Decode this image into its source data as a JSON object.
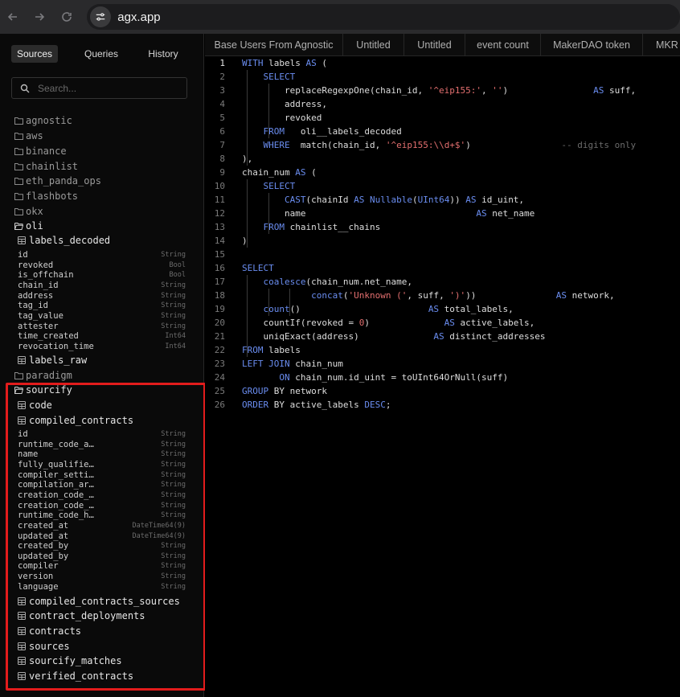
{
  "browser": {
    "url": "agx.app"
  },
  "sidebar": {
    "tabs": [
      "Sources",
      "Queries",
      "History"
    ],
    "search_placeholder": "Search...",
    "folders": [
      "agnostic",
      "aws",
      "binance",
      "chainlist",
      "eth_panda_ops",
      "flashbots",
      "okx"
    ],
    "oli": {
      "name": "oli",
      "tables": [
        {
          "name": "labels_decoded",
          "columns": [
            {
              "name": "id",
              "type": "String"
            },
            {
              "name": "revoked",
              "type": "Bool"
            },
            {
              "name": "is_offchain",
              "type": "Bool"
            },
            {
              "name": "chain_id",
              "type": "String"
            },
            {
              "name": "address",
              "type": "String"
            },
            {
              "name": "tag_id",
              "type": "String"
            },
            {
              "name": "tag_value",
              "type": "String"
            },
            {
              "name": "attester",
              "type": "String"
            },
            {
              "name": "time_created",
              "type": "Int64"
            },
            {
              "name": "revocation_time",
              "type": "Int64"
            }
          ]
        },
        {
          "name": "labels_raw"
        }
      ]
    },
    "paradigm": "paradigm",
    "sourcify": {
      "name": "sourcify",
      "tables": [
        {
          "name": "code"
        },
        {
          "name": "compiled_contracts",
          "columns": [
            {
              "name": "id",
              "type": "String"
            },
            {
              "name": "runtime_code_a…",
              "type": "String"
            },
            {
              "name": "name",
              "type": "String"
            },
            {
              "name": "fully_qualifie…",
              "type": "String"
            },
            {
              "name": "compiler_setti…",
              "type": "String"
            },
            {
              "name": "compilation_ar…",
              "type": "String"
            },
            {
              "name": "creation_code_…",
              "type": "String"
            },
            {
              "name": "creation_code_…",
              "type": "String"
            },
            {
              "name": "runtime_code_h…",
              "type": "String"
            },
            {
              "name": "created_at",
              "type": "DateTime64(9)"
            },
            {
              "name": "updated_at",
              "type": "DateTime64(9)"
            },
            {
              "name": "created_by",
              "type": "String"
            },
            {
              "name": "updated_by",
              "type": "String"
            },
            {
              "name": "compiler",
              "type": "String"
            },
            {
              "name": "version",
              "type": "String"
            },
            {
              "name": "language",
              "type": "String"
            }
          ]
        },
        {
          "name": "compiled_contracts_sources"
        },
        {
          "name": "contract_deployments"
        },
        {
          "name": "contracts"
        },
        {
          "name": "sources"
        },
        {
          "name": "sourcify_matches"
        },
        {
          "name": "verified_contracts"
        }
      ]
    }
  },
  "editor": {
    "tabs": [
      "Base Users From Agnostic",
      "Untitled",
      "Untitled",
      "event count",
      "MakerDAO token",
      "MKR"
    ],
    "active_line": 1,
    "lines": [
      [
        [
          "kw",
          "WITH"
        ],
        [
          "t",
          " labels "
        ],
        [
          "kw",
          "AS"
        ],
        [
          "t",
          " ("
        ]
      ],
      [
        [
          "t",
          "    "
        ],
        [
          "kw",
          "SELECT"
        ]
      ],
      [
        [
          "t",
          "        replaceRegexpOne(chain_id, "
        ],
        [
          "str",
          "'^eip155:'"
        ],
        [
          "t",
          ", "
        ],
        [
          "str",
          "''"
        ],
        [
          "t",
          ")                "
        ],
        [
          "kw",
          "AS"
        ],
        [
          "t",
          " suff,"
        ]
      ],
      [
        [
          "t",
          "        address,"
        ]
      ],
      [
        [
          "t",
          "        revoked"
        ]
      ],
      [
        [
          "t",
          "    "
        ],
        [
          "kw",
          "FROM"
        ],
        [
          "t",
          "   oli__labels_decoded"
        ]
      ],
      [
        [
          "t",
          "    "
        ],
        [
          "kw",
          "WHERE"
        ],
        [
          "t",
          "  match(chain_id, "
        ],
        [
          "str",
          "'^eip155:\\\\d+$'"
        ],
        [
          "t",
          ")                 "
        ],
        [
          "cm",
          "-- digits only"
        ]
      ],
      [
        [
          "t",
          "),"
        ]
      ],
      [
        [
          "t",
          "chain_num "
        ],
        [
          "kw",
          "AS"
        ],
        [
          "t",
          " ("
        ]
      ],
      [
        [
          "t",
          "    "
        ],
        [
          "kw",
          "SELECT"
        ]
      ],
      [
        [
          "t",
          "        "
        ],
        [
          "kw",
          "CAST"
        ],
        [
          "t",
          "(chainId "
        ],
        [
          "kw",
          "AS"
        ],
        [
          "t",
          " "
        ],
        [
          "kw",
          "Nullable"
        ],
        [
          "t",
          "("
        ],
        [
          "kw",
          "UInt64"
        ],
        [
          "t",
          ")) "
        ],
        [
          "kw",
          "AS"
        ],
        [
          "t",
          " id_uint,"
        ]
      ],
      [
        [
          "t",
          "        name                                "
        ],
        [
          "kw",
          "AS"
        ],
        [
          "t",
          " net_name"
        ]
      ],
      [
        [
          "t",
          "    "
        ],
        [
          "kw",
          "FROM"
        ],
        [
          "t",
          " chainlist__chains"
        ]
      ],
      [
        [
          "t",
          ")"
        ]
      ],
      [
        [
          "t",
          ""
        ]
      ],
      [
        [
          "kw",
          "SELECT"
        ]
      ],
      [
        [
          "t",
          "    "
        ],
        [
          "kw",
          "coalesce"
        ],
        [
          "t",
          "(chain_num.net_name,"
        ]
      ],
      [
        [
          "t",
          "             "
        ],
        [
          "kw",
          "concat"
        ],
        [
          "t",
          "("
        ],
        [
          "str",
          "'Unknown ('"
        ],
        [
          "t",
          ", suff, "
        ],
        [
          "str",
          "')'"
        ],
        [
          "t",
          "))               "
        ],
        [
          "kw",
          "AS"
        ],
        [
          "t",
          " network,"
        ]
      ],
      [
        [
          "t",
          "    "
        ],
        [
          "kw",
          "count"
        ],
        [
          "t",
          "()                        "
        ],
        [
          "kw",
          "AS"
        ],
        [
          "t",
          " total_labels,"
        ]
      ],
      [
        [
          "t",
          "    countIf(revoked = "
        ],
        [
          "str",
          "0"
        ],
        [
          "t",
          ")              "
        ],
        [
          "kw",
          "AS"
        ],
        [
          "t",
          " active_labels,"
        ]
      ],
      [
        [
          "t",
          "    uniqExact(address)              "
        ],
        [
          "kw",
          "AS"
        ],
        [
          "t",
          " distinct_addresses"
        ]
      ],
      [
        [
          "kw",
          "FROM"
        ],
        [
          "t",
          " labels"
        ]
      ],
      [
        [
          "kw",
          "LEFT JOIN"
        ],
        [
          "t",
          " chain_num"
        ]
      ],
      [
        [
          "t",
          "       "
        ],
        [
          "kw",
          "ON"
        ],
        [
          "t",
          " chain_num.id_uint = toUInt64OrNull(suff)"
        ]
      ],
      [
        [
          "kw",
          "GROUP"
        ],
        [
          "t",
          " BY network"
        ]
      ],
      [
        [
          "kw",
          "ORDER"
        ],
        [
          "t",
          " BY active_labels "
        ],
        [
          "kw",
          "DESC"
        ],
        [
          "t",
          ";"
        ]
      ]
    ]
  }
}
